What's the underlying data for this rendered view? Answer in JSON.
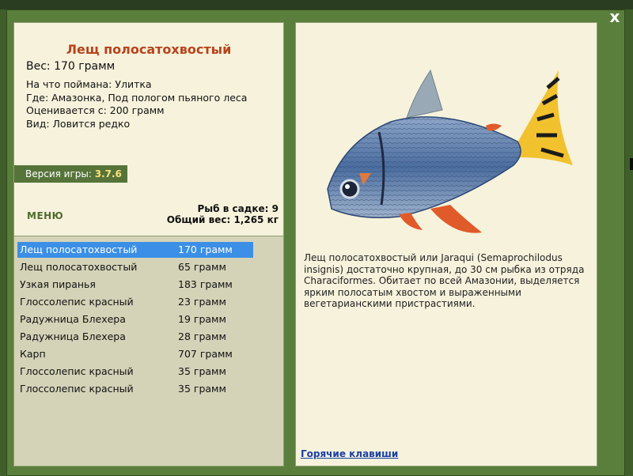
{
  "close_label": "x",
  "fish": {
    "title": "Лещ полосатохвостый",
    "weight": "Вес: 170 грамм",
    "caught_on": "На что поймана: Улитка",
    "location": "Где: Амазонка, Под пологом пьяного леса",
    "valued_from": "Оценивается с: 200 грамм",
    "kind": "Вид: Ловится редко"
  },
  "version": {
    "label": "Версия игры:",
    "value": "3.7.6"
  },
  "menu_label": "МЕНЮ",
  "cage": {
    "count": "Рыб в садке: 9",
    "total_weight": "Общий вес: 1,265 кг"
  },
  "catch_list": [
    {
      "name": "Лещ полосатохвостый",
      "weight": "170 грамм",
      "selected": true
    },
    {
      "name": "Лещ полосатохвостый",
      "weight": "65 грамм"
    },
    {
      "name": "Узкая пиранья",
      "weight": "183 грамм"
    },
    {
      "name": "Глоссолепис красный",
      "weight": "23 грамм"
    },
    {
      "name": "Радужница Блехера",
      "weight": "19 грамм"
    },
    {
      "name": "Радужница Блехера",
      "weight": "28 грамм"
    },
    {
      "name": "Карп",
      "weight": "707 грамм"
    },
    {
      "name": "Глоссолепис красный",
      "weight": "35 грамм"
    },
    {
      "name": "Глоссолепис красный",
      "weight": "35 грамм"
    }
  ],
  "description": "Лещ полосатохвостый или Jaraqui (Semaprochilodus insignis) достаточно крупная, до 30 см рыбка из отряда Characiformes. Обитает по всей Амазонии, выделяется ярким полосатым хвостом и выраженными вегетарианскими пристрастиями.",
  "hotkeys_label": "Горячие клавиши",
  "colors": {
    "frame": "#5a7f3c",
    "panel": "#f6f2dc",
    "list_bg": "#d4d3b8",
    "title": "#b7431a",
    "selection": "#3b8fe6",
    "version_value": "#fde27a"
  }
}
